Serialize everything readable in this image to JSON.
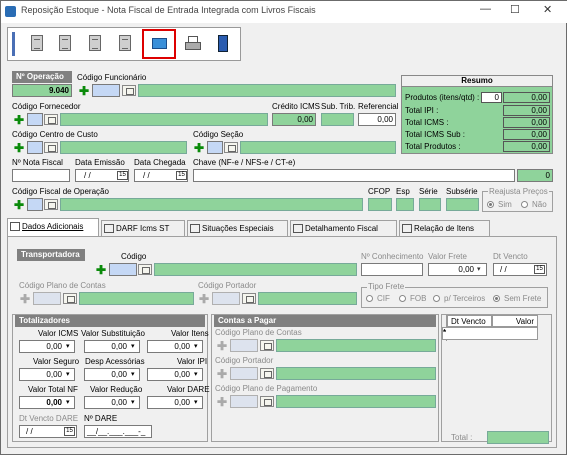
{
  "window": {
    "title": "Reposição Estoque - Nota Fiscal de Entrada Integrada com Livros Fiscais",
    "min": "—",
    "max": "☐",
    "close": "✕"
  },
  "toolbar": {
    "selected_index": 4
  },
  "header": {
    "operacao_label": "Nº Operação",
    "operacao_value": "9.040",
    "funcionario_label": "Código Funcionário",
    "fornecedor_label": "Código Fornecedor",
    "credito_icms_label": "Crédito ICMS",
    "credito_icms_value": "0,00",
    "sub_trib_label": "Sub. Trib.",
    "referencial_label": "Referencial",
    "referencial_value": "0,00",
    "centro_custo_label": "Código Centro de Custo",
    "secao_label": "Código Seção",
    "nota_fiscal_label": "Nº Nota Fiscal",
    "data_emissao_label": "Data Emissão",
    "data_emissao_value": "/ /",
    "data_chegada_label": "Data Chegada",
    "data_chegada_value": "/ /",
    "chave_label": "Chave (NF-e / NFS-e / CT-e)",
    "chave_count": "0",
    "cfo_label": "Código Fiscal de Operação",
    "cfop_label": "CFOP",
    "esp_label": "Esp",
    "serie_label": "Série",
    "subserie_label": "Subsérie",
    "reajusta_label": "Reajusta Preços",
    "sim_label": "Sim",
    "nao_label": "Não"
  },
  "resumo": {
    "title": "Resumo",
    "produtos_label": "Produtos (itens/qtd) :",
    "produtos_itens": "0",
    "produtos_qtd": "0,00",
    "ipi_label": "Total IPI :",
    "ipi_value": "0,00",
    "icms_label": "Total ICMS :",
    "icms_value": "0,00",
    "icms_sub_label": "Total ICMS Sub :",
    "icms_sub_value": "0,00",
    "produtos_total_label": "Total Produtos :",
    "produtos_total_value": "0,00"
  },
  "tabs": [
    {
      "label": "Dados Adicionais"
    },
    {
      "label": "DARF Icms ST"
    },
    {
      "label": "Situações Especiais"
    },
    {
      "label": "Detalhamento Fiscal"
    },
    {
      "label": "Relação de Itens"
    }
  ],
  "transportadora": {
    "title": "Transportadora",
    "codigo_label": "Código",
    "conhecimento_label": "Nº Conhecimento",
    "valor_frete_label": "Valor Frete",
    "valor_frete_value": "0,00",
    "dt_vencto_label": "Dt Vencto",
    "dt_vencto_value": "/ /",
    "plano_contas_label": "Código Plano de Contas",
    "portador_label": "Código Portador",
    "tipo_frete_label": "Tipo Frete",
    "cif_label": "CIF",
    "fob_label": "FOB",
    "terceiros_label": "p/ Terceiros",
    "sem_frete_label": "Sem Frete"
  },
  "totalizadores": {
    "title": "Totalizadores",
    "valor_icms_label": "Valor ICMS",
    "valor_icms": "0,00",
    "valor_subst_label": "Valor Substituição",
    "valor_subst": "0,00",
    "valor_itens_label": "Valor Itens",
    "valor_itens": "0,00",
    "valor_seguro_label": "Valor Seguro",
    "valor_seguro": "0,00",
    "desp_acess_label": "Desp Acessórias",
    "desp_acess": "0,00",
    "valor_ipi_label": "Valor IPI",
    "valor_ipi": "0,00",
    "valor_total_label": "Valor Total NF",
    "valor_total": "0,00",
    "valor_reducao_label": "Valor Redução",
    "valor_reducao": "0,00",
    "valor_dare_label": "Valor DARE",
    "valor_dare": "0,00",
    "dt_vencto_dare_label": "Dt Vencto DARE",
    "dt_vencto_dare": "/ /",
    "n_dare_label": "Nº DARE",
    "n_dare": "__/__.___.___-_"
  },
  "contas_pagar": {
    "title": "Contas a Pagar",
    "plano_contas_label": "Código Plano de Contas",
    "portador_label": "Código Portador",
    "plano_pagamento_label": "Código Plano de Pagamento"
  },
  "parcelas": {
    "col_vencto": "Dt Vencto",
    "col_valor": "Valor",
    "row_marker": "*",
    "total_label": "Total :"
  }
}
